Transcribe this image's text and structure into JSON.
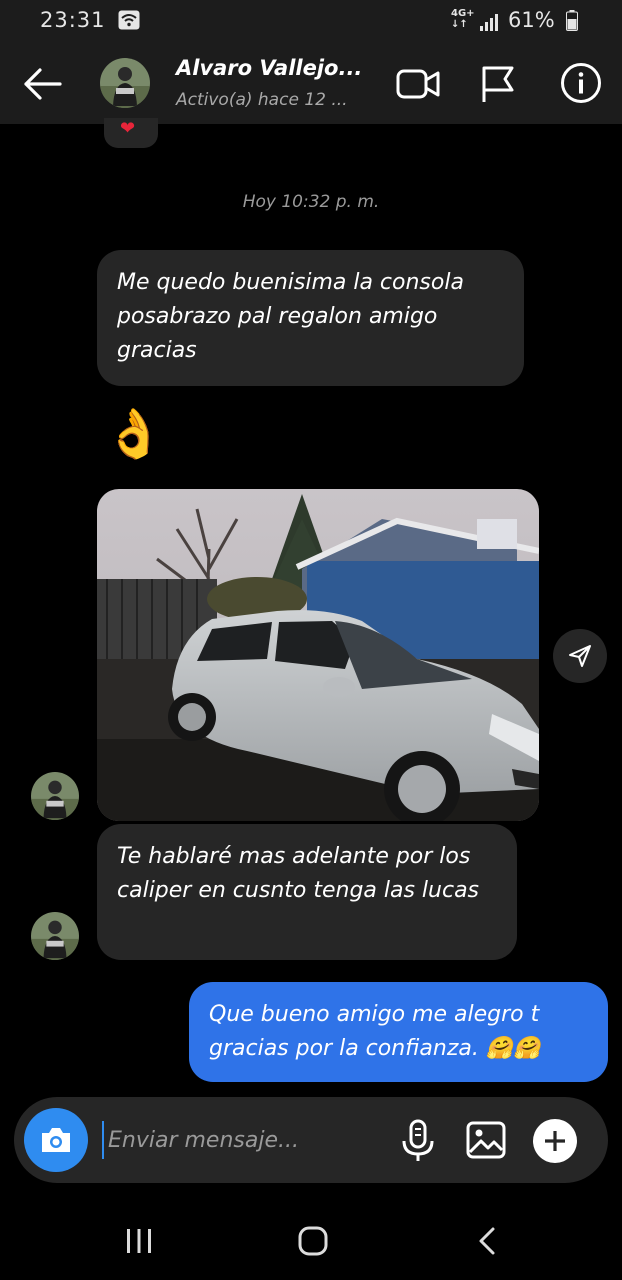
{
  "status_bar": {
    "time": "23:31",
    "network": "4G+",
    "network_arrows": "↓↑",
    "battery": "61%"
  },
  "header": {
    "contact_name": "Alvaro Vallejo...",
    "contact_status": "Activo(a) hace 12 ...",
    "icons": [
      "back-arrow-icon",
      "video-call-icon",
      "flag-icon",
      "info-icon"
    ]
  },
  "chat": {
    "reaction": "❤",
    "timestamp": "Hoy 10:32 p. m.",
    "messages": [
      {
        "from": "contact",
        "text": "Me quedo buenisima la consola posabrazo pal regalon amigo gracias"
      },
      {
        "from": "contact",
        "text": "👌"
      },
      {
        "from": "contact",
        "type": "photo"
      },
      {
        "from": "contact",
        "text": "Te hablaré mas adelante por los caliper en cusnto tenga las lucas"
      },
      {
        "from": "me",
        "text": "Que bueno amigo me alegro t gracias por la confianza. 🤗🤗"
      }
    ]
  },
  "composer": {
    "placeholder": "Enviar mensaje..."
  },
  "colors": {
    "background": "#000000",
    "bar": "#1c1c1c",
    "incoming_bubble": "#262626",
    "outgoing_bubble": "#2f73e8",
    "camera_button": "#2f8cf0"
  }
}
